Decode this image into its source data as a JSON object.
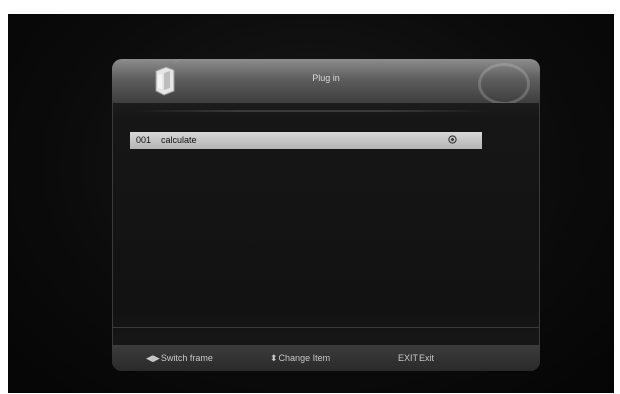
{
  "header": {
    "title": "Plug in",
    "logo_icon": "plugin-logo-icon"
  },
  "list": {
    "items": [
      {
        "number": "001",
        "name": "calculate",
        "icon": "gear-icon",
        "selected": true
      }
    ]
  },
  "footer": {
    "hints": [
      {
        "key": "◀▶",
        "label": "Switch frame",
        "icon": "left-right-arrows-icon"
      },
      {
        "key": "⬍",
        "label": "Change Item",
        "icon": "up-down-arrows-icon"
      },
      {
        "key": "EXIT",
        "label": "Exit",
        "icon": ""
      }
    ]
  },
  "colors": {
    "selection": "#c8c8c8",
    "background": "#0b0b0b",
    "text": "#d8d8d8"
  }
}
